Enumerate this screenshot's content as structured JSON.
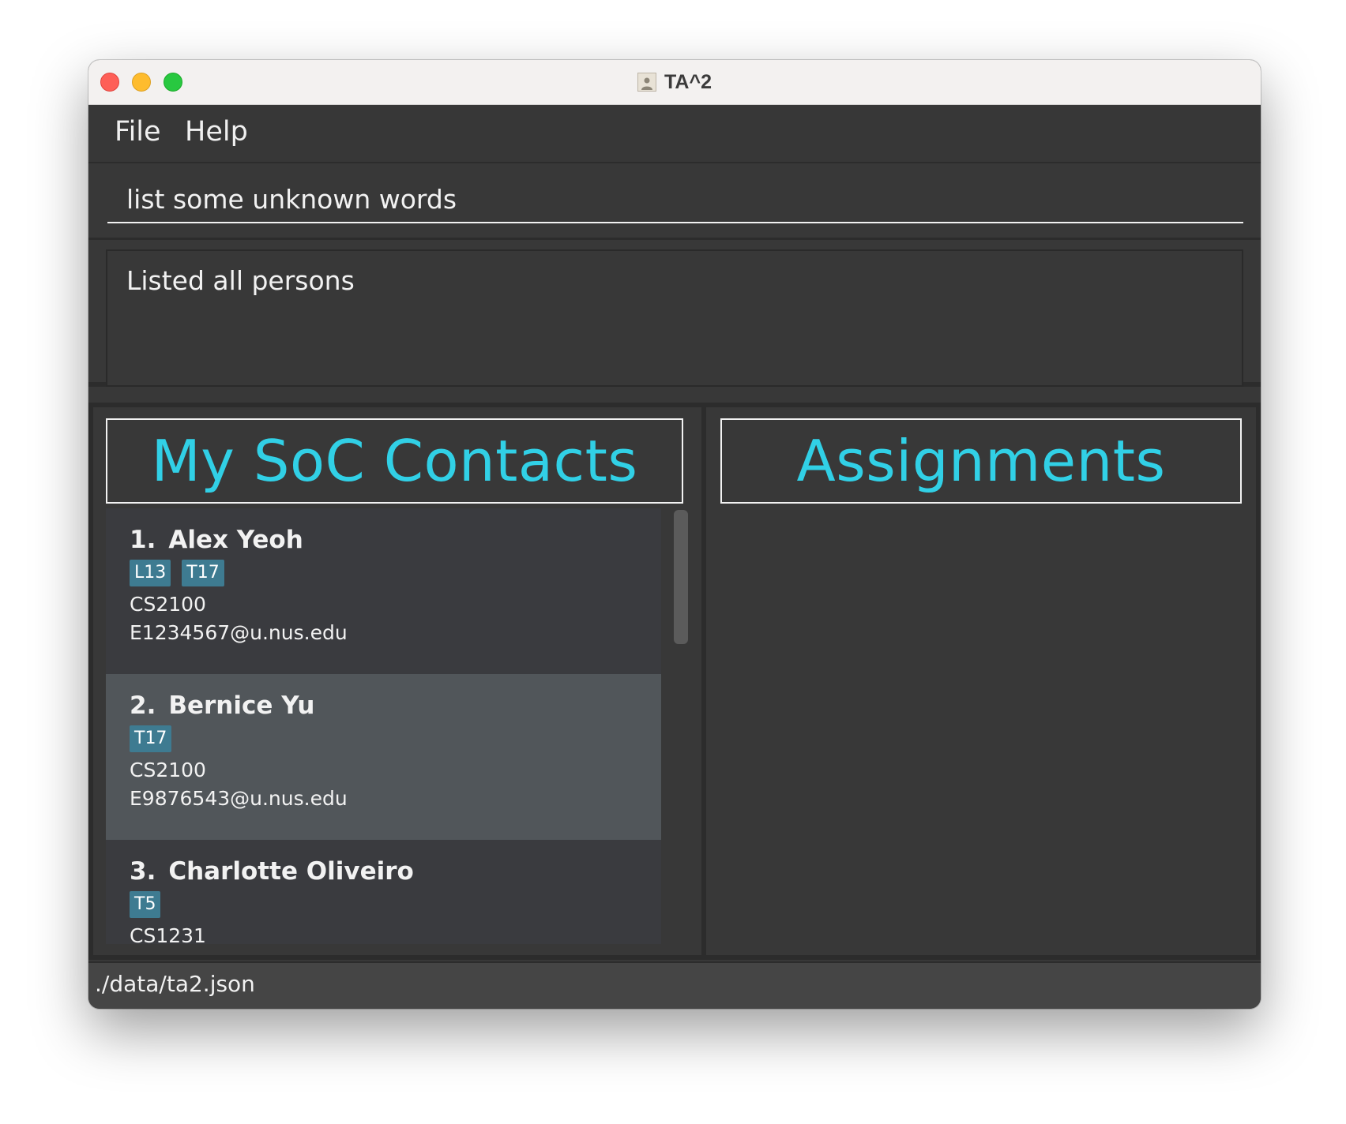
{
  "window": {
    "title": "TA^2"
  },
  "menu": {
    "items": [
      "File",
      "Help"
    ]
  },
  "command": {
    "value": "list some unknown words"
  },
  "result": {
    "text": "Listed all persons"
  },
  "contacts_panel": {
    "title": "My SoC Contacts",
    "persons": [
      {
        "index": "1.",
        "name": "Alex Yeoh",
        "tags": [
          "L13",
          "T17"
        ],
        "module": "CS2100",
        "email": "E1234567@u.nus.edu"
      },
      {
        "index": "2.",
        "name": "Bernice Yu",
        "tags": [
          "T17"
        ],
        "module": "CS2100",
        "email": "E9876543@u.nus.edu"
      },
      {
        "index": "3.",
        "name": "Charlotte Oliveiro",
        "tags": [
          "T5"
        ],
        "module": "CS1231",
        "email": ""
      }
    ]
  },
  "assignments_panel": {
    "title": "Assignments"
  },
  "status": {
    "file_path": "./data/ta2.json"
  },
  "colors": {
    "accent": "#31d0e6",
    "tag": "#3e7b91",
    "background": "#383838",
    "selected": "#51565a"
  }
}
